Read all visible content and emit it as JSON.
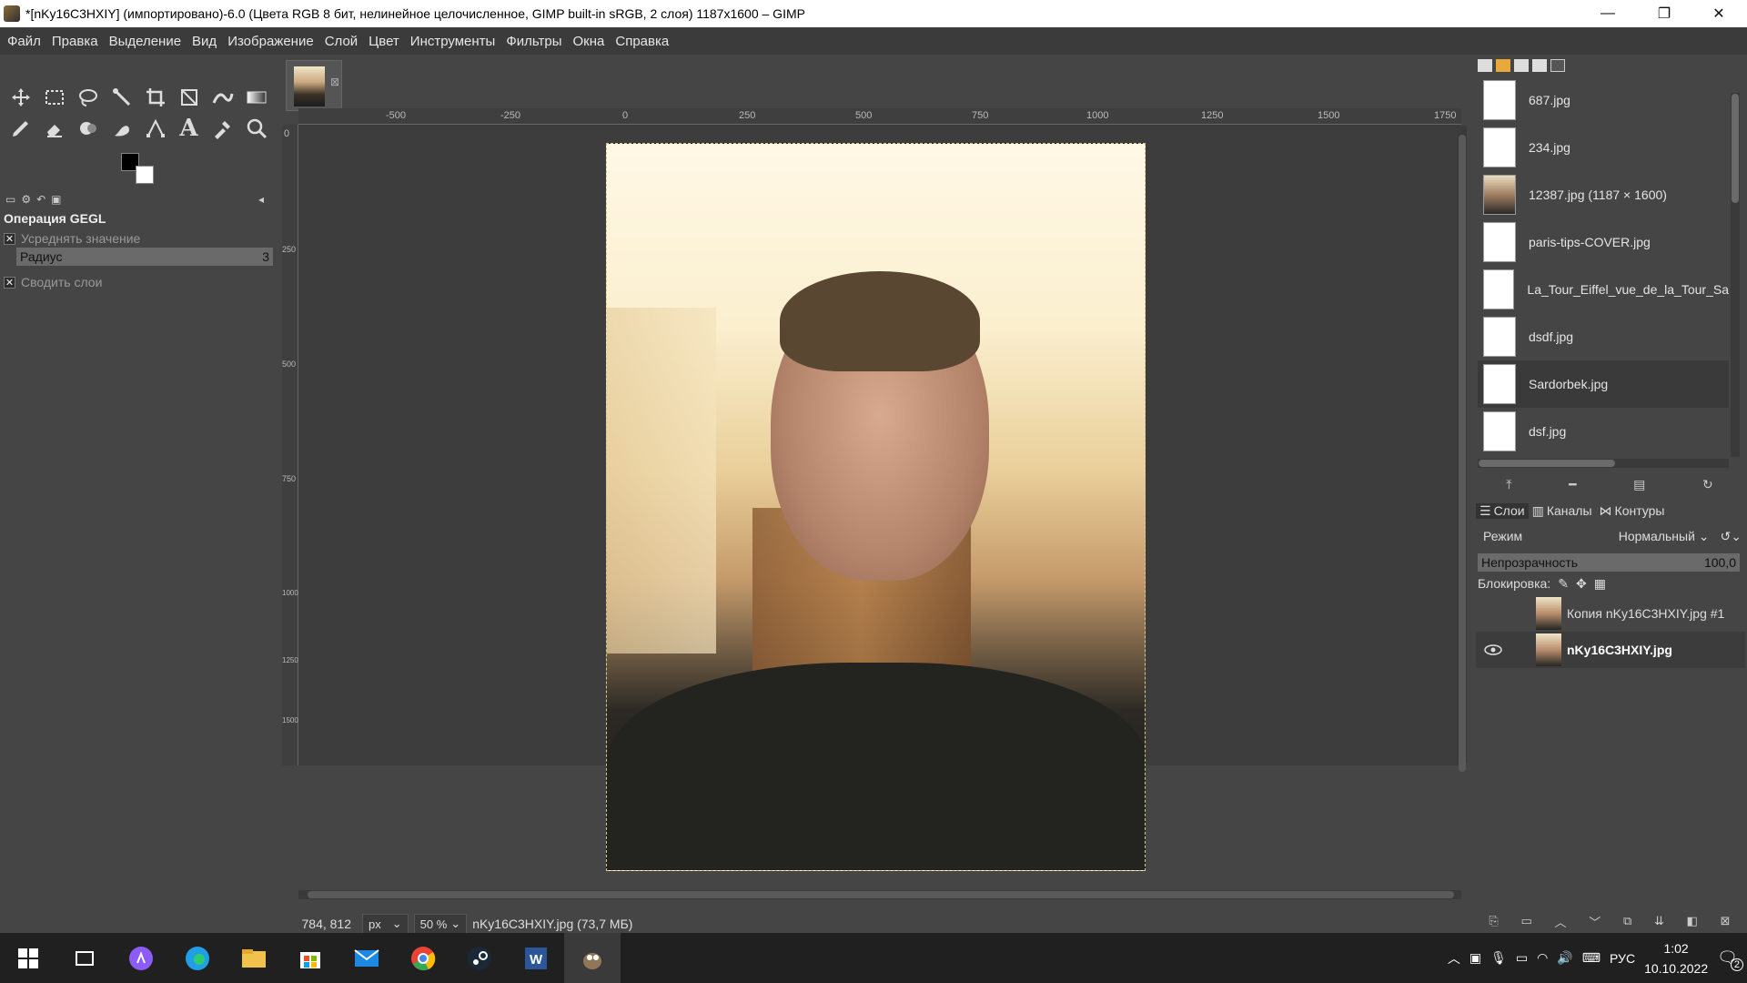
{
  "window": {
    "title": "*[nKy16C3HXIY] (импортировано)-6.0 (Цвета RGB 8 бит, нелинейное целочисленное, GIMP built-in sRGB, 2 слоя) 1187x1600 – GIMP",
    "minimize": "—",
    "maximize": "❐",
    "close": "✕"
  },
  "menu": [
    "Файл",
    "Правка",
    "Выделение",
    "Вид",
    "Изображение",
    "Слой",
    "Цвет",
    "Инструменты",
    "Фильтры",
    "Окна",
    "Справка"
  ],
  "tool_options": {
    "title": "Операция GEGL",
    "average_label": "Усреднять значение",
    "radius_label": "Радиус",
    "radius_value": "3",
    "merge_label": "Сводить слои"
  },
  "ruler": {
    "h_ticks": [
      "-500",
      "-250",
      "0",
      "250",
      "500",
      "750",
      "1000",
      "1250",
      "1500",
      "1750"
    ],
    "v_ticks": [
      "0",
      "250",
      "500",
      "750",
      "1000",
      "1250",
      "1500"
    ]
  },
  "status": {
    "coords": "784, 812",
    "unit": "px",
    "zoom": "50 %",
    "file": "nKy16C3HXIY.jpg (73,7 МБ)"
  },
  "images_panel": {
    "items": [
      {
        "name": "687.jpg",
        "photo": false
      },
      {
        "name": "234.jpg",
        "photo": false
      },
      {
        "name": "12387.jpg (1187 × 1600)",
        "photo": true
      },
      {
        "name": "paris-tips-COVER.jpg",
        "photo": false
      },
      {
        "name": "La_Tour_Eiffel_vue_de_la_Tour_Sain",
        "photo": false
      },
      {
        "name": "dsdf.jpg",
        "photo": false
      },
      {
        "name": "Sardorbek.jpg",
        "photo": false
      },
      {
        "name": "dsf.jpg",
        "photo": false
      }
    ]
  },
  "layers_panel": {
    "tabs": [
      "Слои",
      "Каналы",
      "Контуры"
    ],
    "mode_label": "Режим",
    "mode_value": "Нормальный",
    "opacity_label": "Непрозрачность",
    "opacity_value": "100,0",
    "lock_label": "Блокировка:",
    "layers": [
      {
        "name": "Копия nKy16C3HXIY.jpg #1",
        "visible": false
      },
      {
        "name": "nKy16C3HXIY.jpg",
        "visible": true
      }
    ]
  },
  "taskbar": {
    "lang": "РУС",
    "time": "1:02",
    "date": "10.10.2022",
    "notifications": "2"
  },
  "colors": {
    "accent": "#454545",
    "menubar": "#3b3b3b",
    "taskbar": "#202020"
  }
}
